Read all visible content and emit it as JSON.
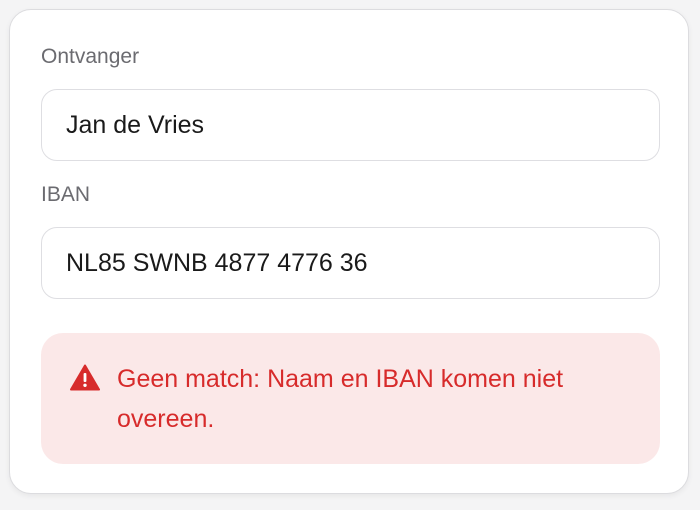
{
  "form": {
    "recipient_label": "Ontvanger",
    "recipient_value": "Jan de Vries",
    "iban_label": "IBAN",
    "iban_value": "NL85 SWNB 4877 4776 36"
  },
  "alert": {
    "icon": "warning-triangle-icon",
    "message": "Geen match: Naam en IBAN komen niet overeen.",
    "color": "#d72b2b",
    "background": "#fbe8e8"
  }
}
